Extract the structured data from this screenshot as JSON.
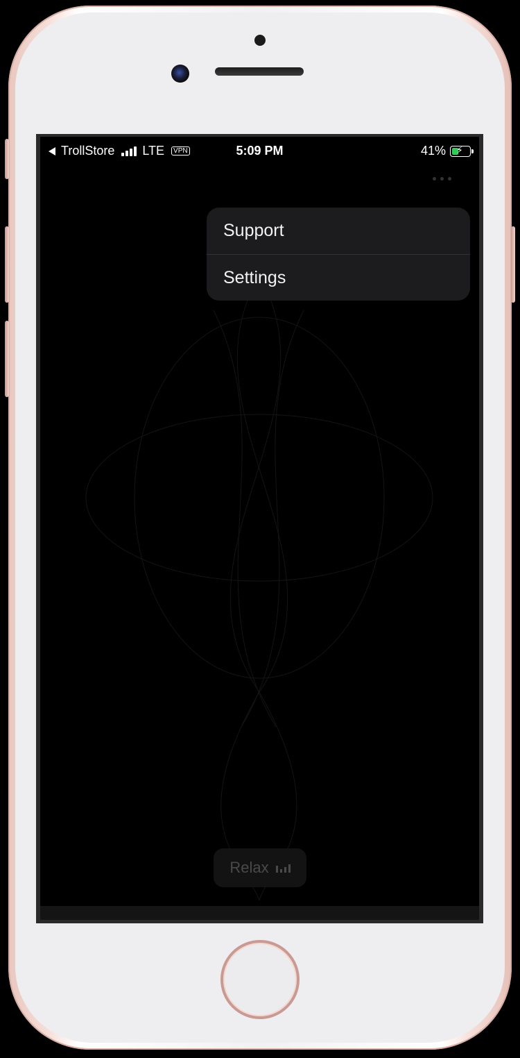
{
  "status_bar": {
    "back_app": "TrollStore",
    "network": "LTE",
    "vpn": "VPN",
    "time": "5:09 PM",
    "battery_percent_label": "41%",
    "battery_level": 0.41,
    "battery_color": "#34c759",
    "signal_bars": 4
  },
  "toolbar": {
    "more_icon": "ellipsis-icon"
  },
  "menu": {
    "items": [
      {
        "label": "Support"
      },
      {
        "label": "Settings"
      }
    ]
  },
  "player": {
    "relax_label": "Relax",
    "relax_icon": "equalizer-icon"
  },
  "device": {
    "frame_color": "#f6dfd9",
    "accent_color": "#c89a93"
  }
}
